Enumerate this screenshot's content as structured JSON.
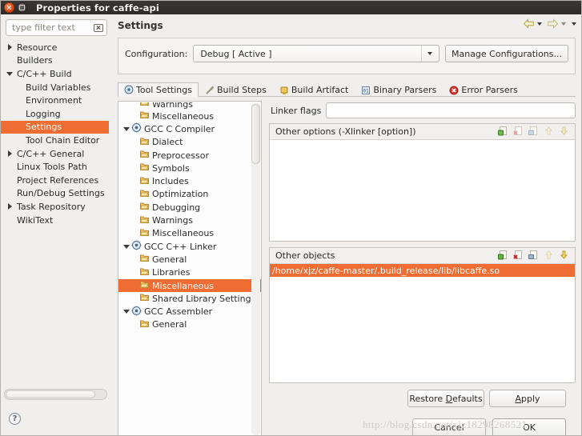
{
  "window": {
    "title": "Properties for caffe-api",
    "close_tooltip": "Close",
    "maximize_tooltip": "Maximize"
  },
  "filter": {
    "placeholder": "type filter text",
    "value": "",
    "clear_icon": "clear-icon"
  },
  "sidebar": {
    "items": [
      {
        "label": "Resource",
        "twisty": "right",
        "indent": 0,
        "selected": false
      },
      {
        "label": "Builders",
        "twisty": "none",
        "indent": 0,
        "selected": false
      },
      {
        "label": "C/C++ Build",
        "twisty": "down",
        "indent": 0,
        "selected": false
      },
      {
        "label": "Build Variables",
        "twisty": "none",
        "indent": 1,
        "selected": false
      },
      {
        "label": "Environment",
        "twisty": "none",
        "indent": 1,
        "selected": false
      },
      {
        "label": "Logging",
        "twisty": "none",
        "indent": 1,
        "selected": false
      },
      {
        "label": "Settings",
        "twisty": "none",
        "indent": 1,
        "selected": true
      },
      {
        "label": "Tool Chain Editor",
        "twisty": "none",
        "indent": 1,
        "selected": false
      },
      {
        "label": "C/C++ General",
        "twisty": "right",
        "indent": 0,
        "selected": false
      },
      {
        "label": "Linux Tools Path",
        "twisty": "none",
        "indent": 0,
        "selected": false
      },
      {
        "label": "Project References",
        "twisty": "none",
        "indent": 0,
        "selected": false
      },
      {
        "label": "Run/Debug Settings",
        "twisty": "none",
        "indent": 0,
        "selected": false
      },
      {
        "label": "Task Repository",
        "twisty": "right",
        "indent": 0,
        "selected": false
      },
      {
        "label": "WikiText",
        "twisty": "none",
        "indent": 0,
        "selected": false
      }
    ],
    "help_icon": "help-icon",
    "help_label": "?"
  },
  "page": {
    "title": "Settings"
  },
  "navigation": {
    "back_icon": "back-arrow-icon",
    "back_menu_icon": "chevron-down-icon",
    "forward_icon": "forward-arrow-icon",
    "forward_menu_icon": "chevron-down-icon",
    "view_menu_icon": "chevron-down-icon"
  },
  "configuration": {
    "label": "Configuration:",
    "selected": "Debug  [ Active ]",
    "options": [
      "Debug  [ Active ]"
    ],
    "dropdown_icon": "chevron-down-icon",
    "manage_button": "Manage Configurations..."
  },
  "tabs": [
    {
      "label": "Tool Settings",
      "icon": "tool-settings-icon",
      "active": true
    },
    {
      "label": "Build Steps",
      "icon": "wrench-icon",
      "active": false
    },
    {
      "label": "Build Artifact",
      "icon": "artifact-icon",
      "active": false
    },
    {
      "label": "Binary Parsers",
      "icon": "binary-parsers-icon",
      "active": false
    },
    {
      "label": "Error Parsers",
      "icon": "error-icon",
      "active": false
    }
  ],
  "tool_tree": {
    "items": [
      {
        "label": "Warnings",
        "twisty": "none",
        "icon": "page-icon",
        "indent": 1,
        "selected": false,
        "clipped": true
      },
      {
        "label": "Miscellaneous",
        "twisty": "none",
        "icon": "page-icon",
        "indent": 1,
        "selected": false,
        "clipped": false
      },
      {
        "label": "GCC C Compiler",
        "twisty": "down",
        "icon": "gear-icon",
        "indent": 0,
        "selected": false,
        "clipped": false
      },
      {
        "label": "Dialect",
        "twisty": "none",
        "icon": "page-icon",
        "indent": 1,
        "selected": false,
        "clipped": false
      },
      {
        "label": "Preprocessor",
        "twisty": "none",
        "icon": "page-icon",
        "indent": 1,
        "selected": false,
        "clipped": false
      },
      {
        "label": "Symbols",
        "twisty": "none",
        "icon": "page-icon",
        "indent": 1,
        "selected": false,
        "clipped": false
      },
      {
        "label": "Includes",
        "twisty": "none",
        "icon": "page-icon",
        "indent": 1,
        "selected": false,
        "clipped": false
      },
      {
        "label": "Optimization",
        "twisty": "none",
        "icon": "page-icon",
        "indent": 1,
        "selected": false,
        "clipped": false
      },
      {
        "label": "Debugging",
        "twisty": "none",
        "icon": "page-icon",
        "indent": 1,
        "selected": false,
        "clipped": false
      },
      {
        "label": "Warnings",
        "twisty": "none",
        "icon": "page-icon",
        "indent": 1,
        "selected": false,
        "clipped": false
      },
      {
        "label": "Miscellaneous",
        "twisty": "none",
        "icon": "page-icon",
        "indent": 1,
        "selected": false,
        "clipped": false
      },
      {
        "label": "GCC C++ Linker",
        "twisty": "down",
        "icon": "gear-icon",
        "indent": 0,
        "selected": false,
        "clipped": false
      },
      {
        "label": "General",
        "twisty": "none",
        "icon": "page-icon",
        "indent": 1,
        "selected": false,
        "clipped": false
      },
      {
        "label": "Libraries",
        "twisty": "none",
        "icon": "page-icon",
        "indent": 1,
        "selected": false,
        "clipped": false
      },
      {
        "label": "Miscellaneous",
        "twisty": "none",
        "icon": "page-icon",
        "indent": 1,
        "selected": true,
        "clipped": false
      },
      {
        "label": "Shared Library Settings",
        "twisty": "none",
        "icon": "page-icon",
        "indent": 1,
        "selected": false,
        "clipped": false
      },
      {
        "label": "GCC Assembler",
        "twisty": "down",
        "icon": "gear-icon",
        "indent": 0,
        "selected": false,
        "clipped": false
      },
      {
        "label": "General",
        "twisty": "none",
        "icon": "page-icon",
        "indent": 1,
        "selected": false,
        "clipped": false
      }
    ]
  },
  "settings_panel": {
    "linker_flags": {
      "label": "Linker flags",
      "value": ""
    },
    "other_options": {
      "title": "Other options (-Xlinker [option])",
      "rows": [],
      "tools": [
        "add-icon",
        "delete-icon",
        "edit-icon",
        "move-up-icon",
        "move-down-icon"
      ]
    },
    "other_objects": {
      "title": "Other objects",
      "rows": [
        {
          "value": "/home/xjz/caffe-master/.build_release/lib/libcaffe.so",
          "selected": true
        }
      ],
      "tools": [
        "add-icon",
        "delete-icon",
        "edit-icon",
        "move-up-icon",
        "move-down-icon"
      ]
    }
  },
  "footer": {
    "restore_defaults": "Restore Defaults",
    "restore_defaults_mnemonic": "D",
    "apply": "Apply",
    "apply_mnemonic": "A",
    "cancel": "Cancel",
    "ok": "OK"
  },
  "watermark": "http://blog.csdn.net/xjz18298268521",
  "colors": {
    "selection_orange": "#ef6c32",
    "titlebar_dark": "#2e2b29",
    "window_bg": "#f0efee",
    "close_button": "#d64712"
  }
}
